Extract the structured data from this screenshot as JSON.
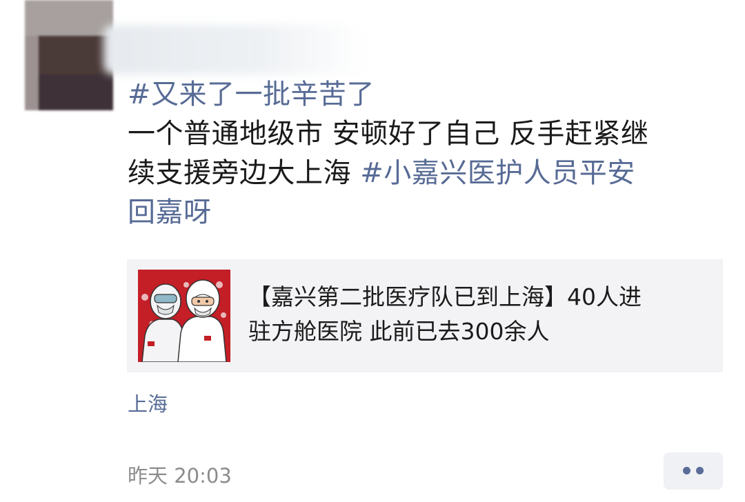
{
  "post": {
    "hashtag_1": "#又来了一批辛苦了",
    "text_line_1": "一个普通地级市 安顿好了自己 反手赶紧继",
    "text_line_2_plain": "续支援旁边大上海 ",
    "hashtag_2_part_1": "#小嘉兴医护人员平安",
    "hashtag_2_part_2": "回嘉呀"
  },
  "share_card": {
    "title_line_1": "【嘉兴第二批医疗队已到上海】40人进",
    "title_line_2": "驻方舱医院  此前已去300余人",
    "thumbnail_icon": "medical-workers-image"
  },
  "location": "上海",
  "timestamp": "昨天 20:03",
  "more_button_icon": "more-dots-icon",
  "colors": {
    "link": "#576b95",
    "text": "#1a1a1a",
    "meta": "#8c8c8c",
    "card_bg": "#f3f3f5",
    "thumb_red": "#c41e26"
  }
}
